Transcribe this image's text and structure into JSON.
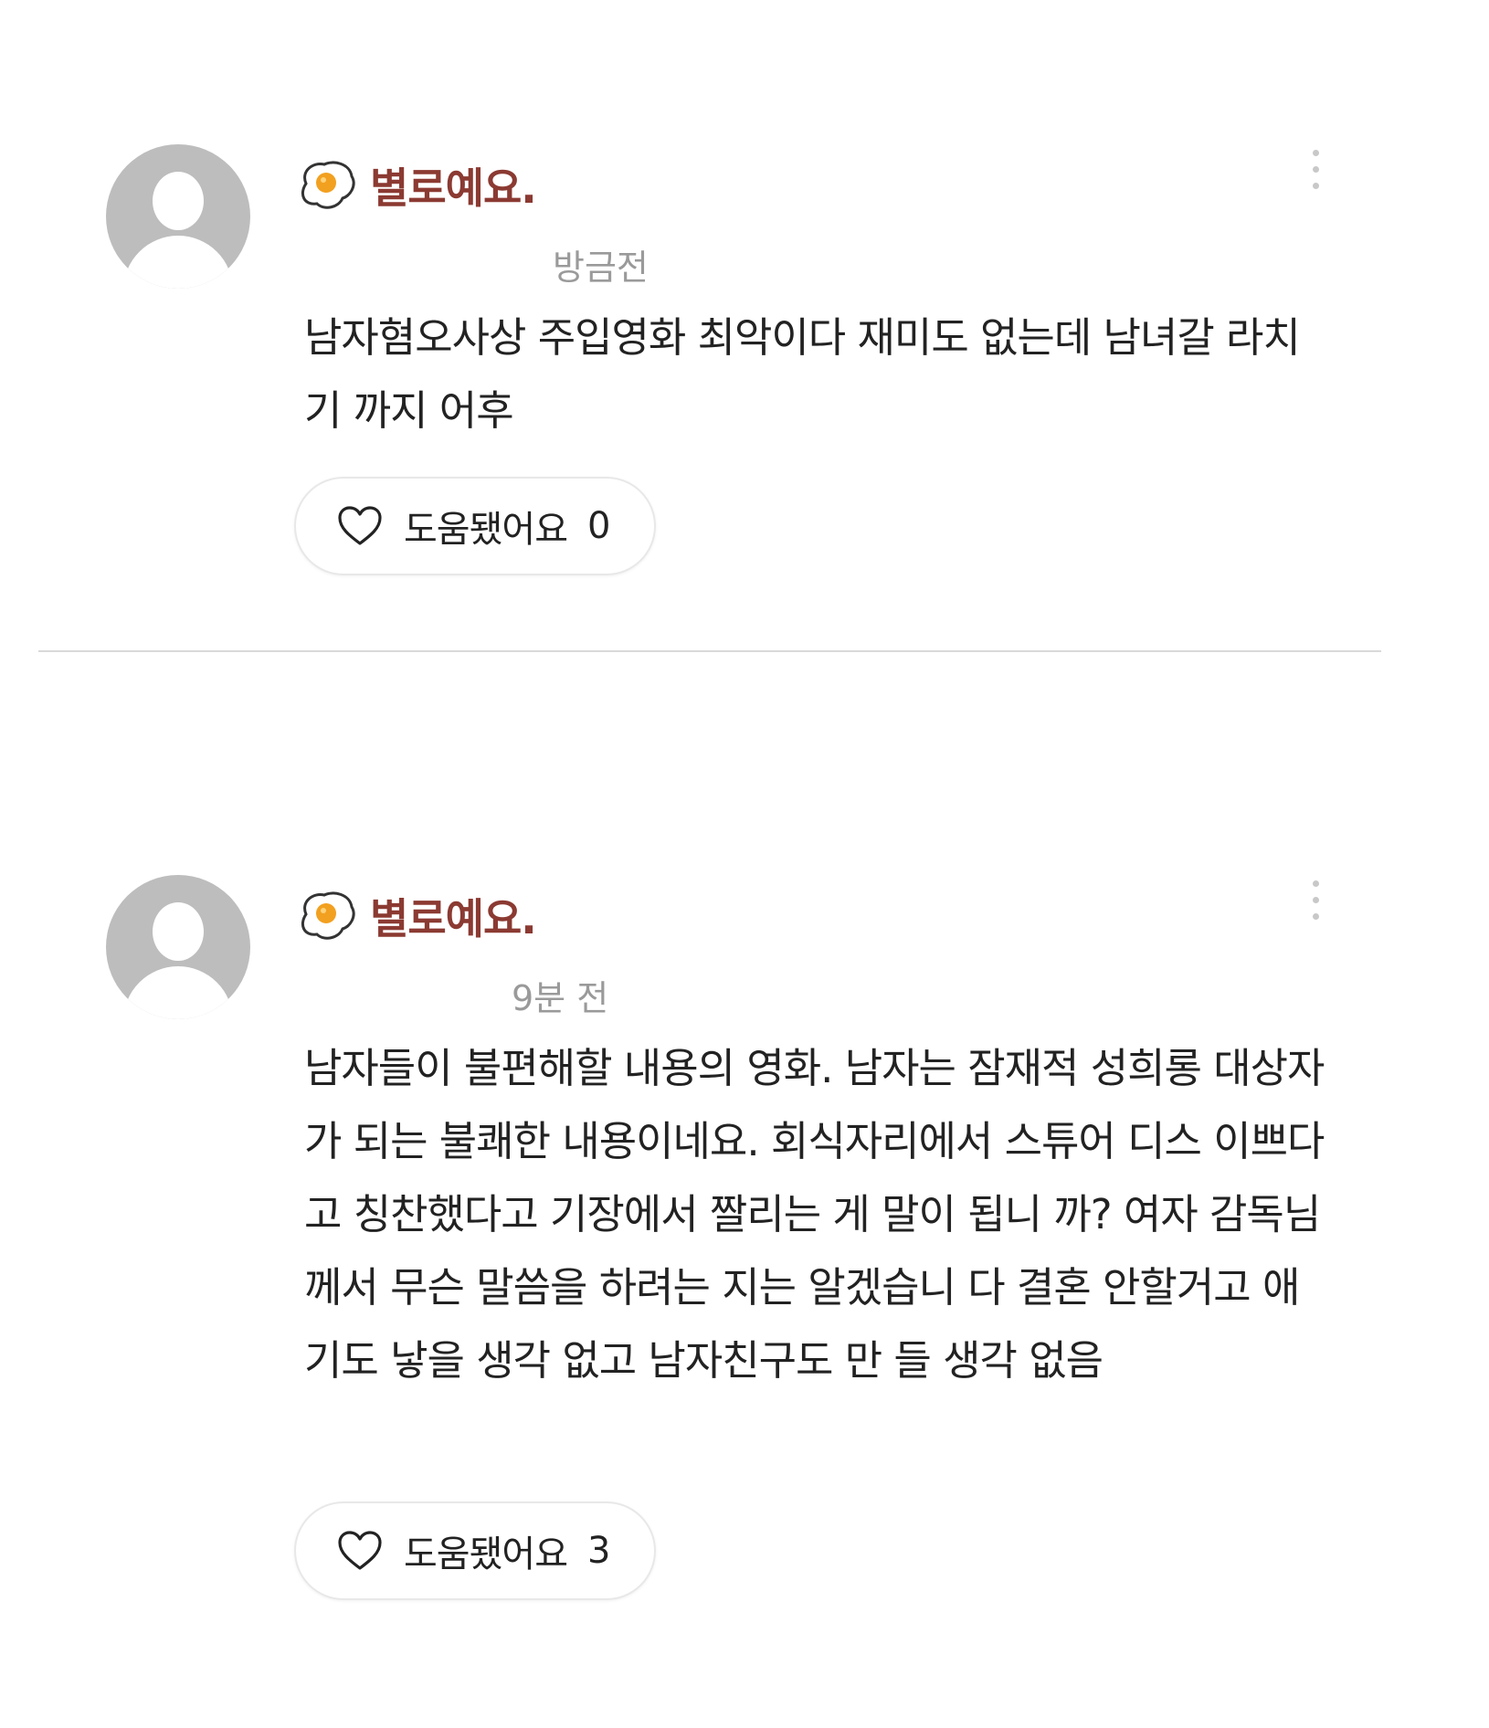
{
  "reviews": [
    {
      "rating_label": "별로예요.",
      "timestamp": "방금전",
      "content": "남자혐오사상 주입영화 최악이다 재미도 없는데 남녀갈 라치기 까지 어후",
      "helpful_label": "도움됐어요",
      "helpful_count": "0"
    },
    {
      "rating_label": "별로예요.",
      "timestamp": "9분 전",
      "content": "남자들이 불편해할 내용의 영화. 남자는 잠재적 성희롱 대상자가 되는 불쾌한 내용이네요. 회식자리에서 스튜어 디스 이쁘다고 칭찬했다고 기장에서 짤리는 게 말이 됩니 까? 여자 감독님께서 무슨 말씀을 하려는 지는 알겠습니 다 결혼 안할거고 애기도 낳을 생각 없고 남자친구도 만 들 생각 없음",
      "helpful_label": "도움됐어요",
      "helpful_count": "3"
    }
  ],
  "icons": {
    "avatar": "default-user-avatar",
    "rating": "fried-egg-icon",
    "more": "vertical-ellipsis-icon",
    "helpful": "heart-outline-icon"
  },
  "colors": {
    "rating_label": "#8b3a32",
    "timestamp": "#9a9a9a",
    "avatar_bg": "#bdbdbd",
    "egg_yolk": "#f2a020",
    "divider": "#d9d9d9"
  }
}
